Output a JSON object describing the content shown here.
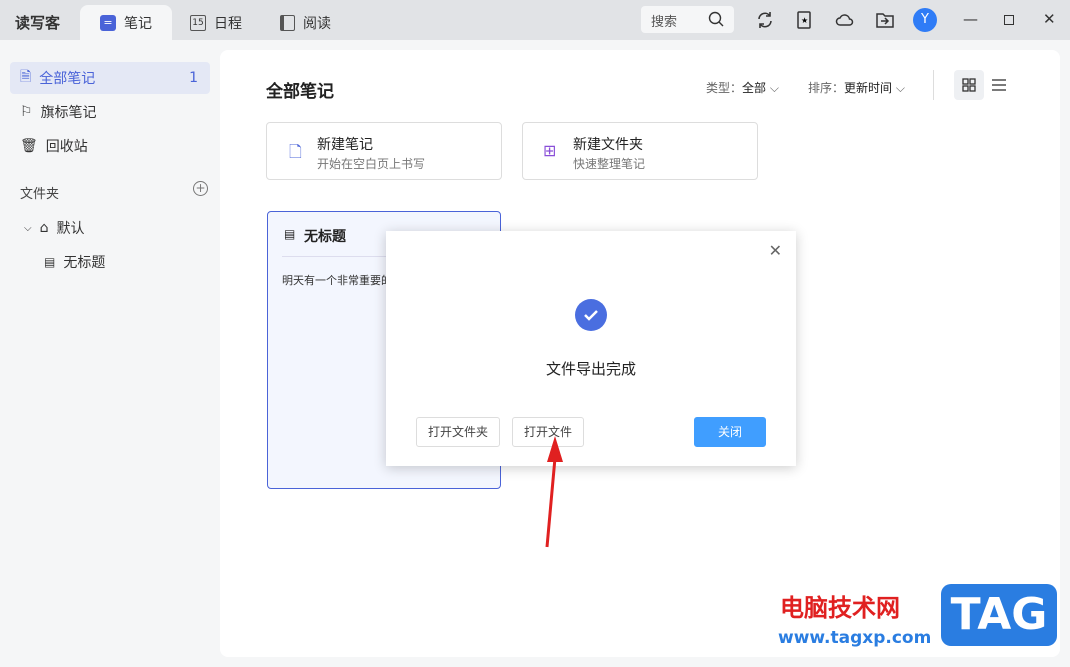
{
  "app": {
    "name": "读写客"
  },
  "tabs": [
    {
      "label": "笔记",
      "active": true
    },
    {
      "label": "日程",
      "icon_text": "15"
    },
    {
      "label": "阅读"
    }
  ],
  "titlebar": {
    "search_placeholder": "搜索",
    "avatar_letter": "Y"
  },
  "sidebar": {
    "items": [
      {
        "label": "全部笔记",
        "count": "1",
        "active": true
      },
      {
        "label": "旗标笔记"
      },
      {
        "label": "回收站"
      }
    ],
    "folders_label": "文件夹",
    "folders": [
      {
        "label": "默认",
        "children": [
          {
            "label": "无标题"
          }
        ]
      }
    ]
  },
  "main": {
    "title": "全部笔记",
    "type_filter": {
      "label": "类型：",
      "value": "全部"
    },
    "sort_filter": {
      "label": "排序：",
      "value": "更新时间"
    },
    "actions": [
      {
        "title": "新建笔记",
        "subtitle": "开始在空白页上书写"
      },
      {
        "title": "新建文件夹",
        "subtitle": "快速整理笔记"
      }
    ],
    "notes": [
      {
        "title": "无标题",
        "preview": "明天有一个非常重要的"
      }
    ]
  },
  "dialog": {
    "message": "文件导出完成",
    "open_folder": "打开文件夹",
    "open_file": "打开文件",
    "close": "关闭"
  },
  "watermark": {
    "text": "电脑技术网",
    "url": "www.tagxp.com",
    "logo": "TAG"
  },
  "colors": {
    "accent": "#4a63d8",
    "primary_button": "#409eff",
    "annotation_arrow": "#e02020"
  }
}
